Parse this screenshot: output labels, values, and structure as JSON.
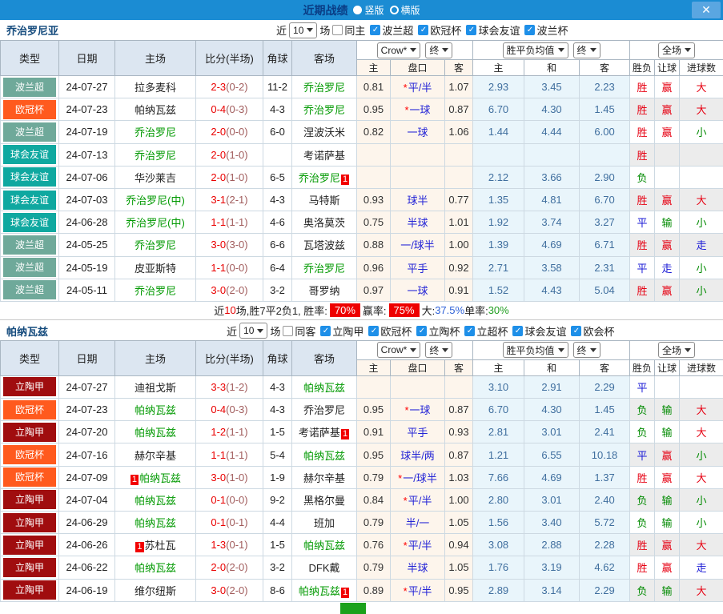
{
  "titlebar": {
    "title": "近期战绩",
    "vertical_label": "竖版",
    "horizontal_label": "横版",
    "close_glyph": "✕",
    "bar_color": "#1b8cd3"
  },
  "columns": {
    "left": [
      "类型",
      "日期",
      "主场",
      "比分(半场)",
      "角球",
      "客场"
    ],
    "crow_group": {
      "select1": "Crow*",
      "select2": "终",
      "subs": [
        "主",
        "盘口",
        "客"
      ]
    },
    "mean_group": {
      "select1": "胜平负均值",
      "select2": "终",
      "subs": [
        "主",
        "和",
        "客"
      ]
    },
    "full_group": {
      "select": "全场",
      "subs": [
        "胜负",
        "让球",
        "进球数"
      ]
    }
  },
  "league_colors": {
    "波兰超": "#6FA99A",
    "欧冠杯": "#FF5A1E",
    "球会友谊": "#0FA8A0",
    "立陶甲": "#A00D0F"
  },
  "result_colors": {
    "red": "#E60012",
    "green": "#008A00",
    "blue": "#1A1AD6"
  },
  "sections": [
    {
      "team": "乔治罗尼亚",
      "filter": {
        "near": "近",
        "count": "10",
        "games": "场",
        "same": "同主",
        "same_checked": false,
        "leagues": [
          "波兰超",
          "欧冠杯",
          "球会友谊",
          "波兰杯"
        ]
      },
      "rows": [
        {
          "league": "波兰超",
          "date": "24-07-27",
          "home": {
            "name": "拉多麦科"
          },
          "score": {
            "ft": "2-3",
            "ht": "(0-2)"
          },
          "corner": "11-2",
          "away": {
            "name": "乔治罗尼",
            "green": true
          },
          "crow": {
            "home": "0.81",
            "handicap": "平/半",
            "star": true,
            "away": "1.07"
          },
          "mean": {
            "home": "2.93",
            "draw": "3.45",
            "away": "2.23"
          },
          "results": {
            "outcome": "胜",
            "handicap": "赢",
            "goals": "大"
          }
        },
        {
          "league": "欧冠杯",
          "date": "24-07-23",
          "home": {
            "name": "帕纳瓦兹"
          },
          "score": {
            "ft": "0-4",
            "ht": "(0-3)"
          },
          "corner": "4-3",
          "away": {
            "name": "乔治罗尼",
            "green": true
          },
          "crow": {
            "home": "0.95",
            "handicap": "一球",
            "star": true,
            "away": "0.87"
          },
          "mean": {
            "home": "6.70",
            "draw": "4.30",
            "away": "1.45"
          },
          "results": {
            "outcome": "胜",
            "handicap": "赢",
            "goals": "大"
          }
        },
        {
          "league": "波兰超",
          "date": "24-07-19",
          "home": {
            "name": "乔治罗尼",
            "green": true
          },
          "score": {
            "ft": "2-0",
            "ht": "(0-0)"
          },
          "corner": "6-0",
          "away": {
            "name": "涅波沃米"
          },
          "crow": {
            "home": "0.82",
            "handicap": "一球",
            "star": false,
            "away": "1.06"
          },
          "mean": {
            "home": "1.44",
            "draw": "4.44",
            "away": "6.00"
          },
          "results": {
            "outcome": "胜",
            "handicap": "赢",
            "goals": "小"
          }
        },
        {
          "league": "球会友谊",
          "date": "24-07-13",
          "home": {
            "name": "乔治罗尼",
            "green": true
          },
          "score": {
            "ft": "2-0",
            "ht": "(1-0)"
          },
          "corner": "",
          "away": {
            "name": "考诺萨基"
          },
          "crow": {
            "home": "",
            "handicap": "",
            "star": false,
            "away": ""
          },
          "mean": {
            "home": "",
            "draw": "",
            "away": ""
          },
          "results": {
            "outcome": "胜",
            "handicap": "",
            "goals": ""
          }
        },
        {
          "league": "球会友谊",
          "date": "24-07-06",
          "home": {
            "name": "华沙莱吉"
          },
          "score": {
            "ft": "2-0",
            "ht": "(1-0)"
          },
          "corner": "6-5",
          "away": {
            "name": "乔治罗尼",
            "green": true,
            "badge": "1",
            "badge_pos": "after"
          },
          "crow": {
            "home": "",
            "handicap": "",
            "star": false,
            "away": ""
          },
          "mean": {
            "home": "2.12",
            "draw": "3.66",
            "away": "2.90"
          },
          "results": {
            "outcome": "负",
            "handicap": "",
            "goals": ""
          }
        },
        {
          "league": "球会友谊",
          "date": "24-07-03",
          "home": {
            "name": "乔治罗尼(中)",
            "green": true
          },
          "score": {
            "ft": "3-1",
            "ht": "(2-1)"
          },
          "corner": "4-3",
          "away": {
            "name": "马特斯"
          },
          "crow": {
            "home": "0.93",
            "handicap": "球半",
            "star": false,
            "away": "0.77"
          },
          "mean": {
            "home": "1.35",
            "draw": "4.81",
            "away": "6.70"
          },
          "results": {
            "outcome": "胜",
            "handicap": "赢",
            "goals": "大"
          }
        },
        {
          "league": "球会友谊",
          "date": "24-06-28",
          "home": {
            "name": "乔治罗尼(中)",
            "green": true
          },
          "score": {
            "ft": "1-1",
            "ht": "(1-1)"
          },
          "corner": "4-6",
          "away": {
            "name": "奥洛莫茨"
          },
          "crow": {
            "home": "0.75",
            "handicap": "半球",
            "star": false,
            "away": "1.01"
          },
          "mean": {
            "home": "1.92",
            "draw": "3.74",
            "away": "3.27"
          },
          "results": {
            "outcome": "平",
            "handicap": "输",
            "goals": "小"
          }
        },
        {
          "league": "波兰超",
          "date": "24-05-25",
          "home": {
            "name": "乔治罗尼",
            "green": true
          },
          "score": {
            "ft": "3-0",
            "ht": "(3-0)"
          },
          "corner": "6-6",
          "away": {
            "name": "瓦塔波兹"
          },
          "crow": {
            "home": "0.88",
            "handicap": "一/球半",
            "star": false,
            "away": "1.00"
          },
          "mean": {
            "home": "1.39",
            "draw": "4.69",
            "away": "6.71"
          },
          "results": {
            "outcome": "胜",
            "handicap": "赢",
            "goals": "走"
          }
        },
        {
          "league": "波兰超",
          "date": "24-05-19",
          "home": {
            "name": "皮亚斯特"
          },
          "score": {
            "ft": "1-1",
            "ht": "(0-0)"
          },
          "corner": "6-4",
          "away": {
            "name": "乔治罗尼",
            "green": true
          },
          "crow": {
            "home": "0.96",
            "handicap": "平手",
            "star": false,
            "away": "0.92"
          },
          "mean": {
            "home": "2.71",
            "draw": "3.58",
            "away": "2.31"
          },
          "results": {
            "outcome": "平",
            "handicap": "走",
            "goals": "小"
          }
        },
        {
          "league": "波兰超",
          "date": "24-05-11",
          "home": {
            "name": "乔治罗尼",
            "green": true
          },
          "score": {
            "ft": "3-0",
            "ht": "(2-0)"
          },
          "corner": "3-2",
          "away": {
            "name": "哥罗纳"
          },
          "crow": {
            "home": "0.97",
            "handicap": "一球",
            "star": false,
            "away": "0.91"
          },
          "mean": {
            "home": "1.52",
            "draw": "4.43",
            "away": "5.04"
          },
          "results": {
            "outcome": "胜",
            "handicap": "赢",
            "goals": "小"
          }
        }
      ],
      "summary": {
        "segments": [
          {
            "t": "近"
          },
          {
            "t": "10",
            "c": "red"
          },
          {
            "t": "场,胜7平2负1, 胜率:"
          },
          {
            "t": "70%",
            "badge": true
          },
          {
            "t": " 赢率:"
          },
          {
            "t": "75%",
            "badge": true
          },
          {
            "t": " 大:"
          },
          {
            "t": "37.5%",
            "c": "blue"
          },
          {
            "t": " 单率:"
          },
          {
            "t": "30%",
            "c": "green"
          }
        ]
      }
    },
    {
      "team": "帕纳瓦兹",
      "filter": {
        "near": "近",
        "count": "10",
        "games": "场",
        "same": "同客",
        "same_checked": false,
        "leagues": [
          "立陶甲",
          "欧冠杯",
          "立陶杯",
          "立超杯",
          "球会友谊",
          "欧会杯"
        ]
      },
      "rows": [
        {
          "league": "立陶甲",
          "date": "24-07-27",
          "home": {
            "name": "迪祖戈斯"
          },
          "score": {
            "ft": "3-3",
            "ht": "(1-2)"
          },
          "corner": "4-3",
          "away": {
            "name": "帕纳瓦兹",
            "green": true
          },
          "crow": {
            "home": "",
            "handicap": "",
            "star": false,
            "away": ""
          },
          "mean": {
            "home": "3.10",
            "draw": "2.91",
            "away": "2.29"
          },
          "results": {
            "outcome": "平",
            "handicap": "",
            "goals": ""
          }
        },
        {
          "league": "欧冠杯",
          "date": "24-07-23",
          "home": {
            "name": "帕纳瓦兹",
            "green": true
          },
          "score": {
            "ft": "0-4",
            "ht": "(0-3)"
          },
          "corner": "4-3",
          "away": {
            "name": "乔治罗尼"
          },
          "crow": {
            "home": "0.95",
            "handicap": "一球",
            "star": true,
            "away": "0.87"
          },
          "mean": {
            "home": "6.70",
            "draw": "4.30",
            "away": "1.45"
          },
          "results": {
            "outcome": "负",
            "handicap": "输",
            "goals": "大"
          }
        },
        {
          "league": "立陶甲",
          "date": "24-07-20",
          "home": {
            "name": "帕纳瓦兹",
            "green": true
          },
          "score": {
            "ft": "1-2",
            "ht": "(1-1)"
          },
          "corner": "1-5",
          "away": {
            "name": "考诺萨基",
            "badge": "1",
            "badge_pos": "after"
          },
          "crow": {
            "home": "0.91",
            "handicap": "平手",
            "star": false,
            "away": "0.93"
          },
          "mean": {
            "home": "2.81",
            "draw": "3.01",
            "away": "2.41"
          },
          "results": {
            "outcome": "负",
            "handicap": "输",
            "goals": "大"
          }
        },
        {
          "league": "欧冠杯",
          "date": "24-07-16",
          "home": {
            "name": "赫尔辛基"
          },
          "score": {
            "ft": "1-1",
            "ht": "(1-1)"
          },
          "corner": "5-4",
          "away": {
            "name": "帕纳瓦兹",
            "green": true
          },
          "crow": {
            "home": "0.95",
            "handicap": "球半/两",
            "star": false,
            "away": "0.87"
          },
          "mean": {
            "home": "1.21",
            "draw": "6.55",
            "away": "10.18"
          },
          "results": {
            "outcome": "平",
            "handicap": "赢",
            "goals": "小"
          }
        },
        {
          "league": "欧冠杯",
          "date": "24-07-09",
          "home": {
            "name": "帕纳瓦兹",
            "green": true,
            "badge": "1",
            "badge_pos": "before"
          },
          "score": {
            "ft": "3-0",
            "ht": "(1-0)"
          },
          "corner": "1-9",
          "away": {
            "name": "赫尔辛基"
          },
          "crow": {
            "home": "0.79",
            "handicap": "一/球半",
            "star": true,
            "away": "1.03"
          },
          "mean": {
            "home": "7.66",
            "draw": "4.69",
            "away": "1.37"
          },
          "results": {
            "outcome": "胜",
            "handicap": "赢",
            "goals": "大"
          }
        },
        {
          "league": "立陶甲",
          "date": "24-07-04",
          "home": {
            "name": "帕纳瓦兹",
            "green": true
          },
          "score": {
            "ft": "0-1",
            "ht": "(0-0)"
          },
          "corner": "9-2",
          "away": {
            "name": "黑格尔曼"
          },
          "crow": {
            "home": "0.84",
            "handicap": "平/半",
            "star": true,
            "away": "1.00"
          },
          "mean": {
            "home": "2.80",
            "draw": "3.01",
            "away": "2.40"
          },
          "results": {
            "outcome": "负",
            "handicap": "输",
            "goals": "小"
          }
        },
        {
          "league": "立陶甲",
          "date": "24-06-29",
          "home": {
            "name": "帕纳瓦兹",
            "green": true
          },
          "score": {
            "ft": "0-1",
            "ht": "(0-1)"
          },
          "corner": "4-4",
          "away": {
            "name": "班加"
          },
          "crow": {
            "home": "0.79",
            "handicap": "半/一",
            "star": false,
            "away": "1.05"
          },
          "mean": {
            "home": "1.56",
            "draw": "3.40",
            "away": "5.72"
          },
          "results": {
            "outcome": "负",
            "handicap": "输",
            "goals": "小"
          }
        },
        {
          "league": "立陶甲",
          "date": "24-06-26",
          "home": {
            "name": "苏杜瓦",
            "badge": "1",
            "badge_pos": "before"
          },
          "score": {
            "ft": "1-3",
            "ht": "(0-1)"
          },
          "corner": "1-5",
          "away": {
            "name": "帕纳瓦兹",
            "green": true
          },
          "crow": {
            "home": "0.76",
            "handicap": "平/半",
            "star": true,
            "away": "0.94"
          },
          "mean": {
            "home": "3.08",
            "draw": "2.88",
            "away": "2.28"
          },
          "results": {
            "outcome": "胜",
            "handicap": "赢",
            "goals": "大"
          }
        },
        {
          "league": "立陶甲",
          "date": "24-06-22",
          "home": {
            "name": "帕纳瓦兹",
            "green": true
          },
          "score": {
            "ft": "2-0",
            "ht": "(2-0)"
          },
          "corner": "3-2",
          "away": {
            "name": "DFK戴"
          },
          "crow": {
            "home": "0.79",
            "handicap": "半球",
            "star": false,
            "away": "1.05"
          },
          "mean": {
            "home": "1.76",
            "draw": "3.19",
            "away": "4.62"
          },
          "results": {
            "outcome": "胜",
            "handicap": "赢",
            "goals": "走"
          }
        },
        {
          "league": "立陶甲",
          "date": "24-06-19",
          "home": {
            "name": "维尔纽斯"
          },
          "score": {
            "ft": "3-0",
            "ht": "(2-0)"
          },
          "corner": "8-6",
          "away": {
            "name": "帕纳瓦兹",
            "green": true,
            "badge": "1",
            "badge_pos": "after"
          },
          "crow": {
            "home": "0.89",
            "handicap": "平/半",
            "star": true,
            "away": "0.95"
          },
          "mean": {
            "home": "2.89",
            "draw": "3.14",
            "away": "2.29"
          },
          "results": {
            "outcome": "负",
            "handicap": "输",
            "goals": "大"
          }
        }
      ],
      "summary": {
        "partial_badge": true,
        "segments": []
      }
    }
  ]
}
